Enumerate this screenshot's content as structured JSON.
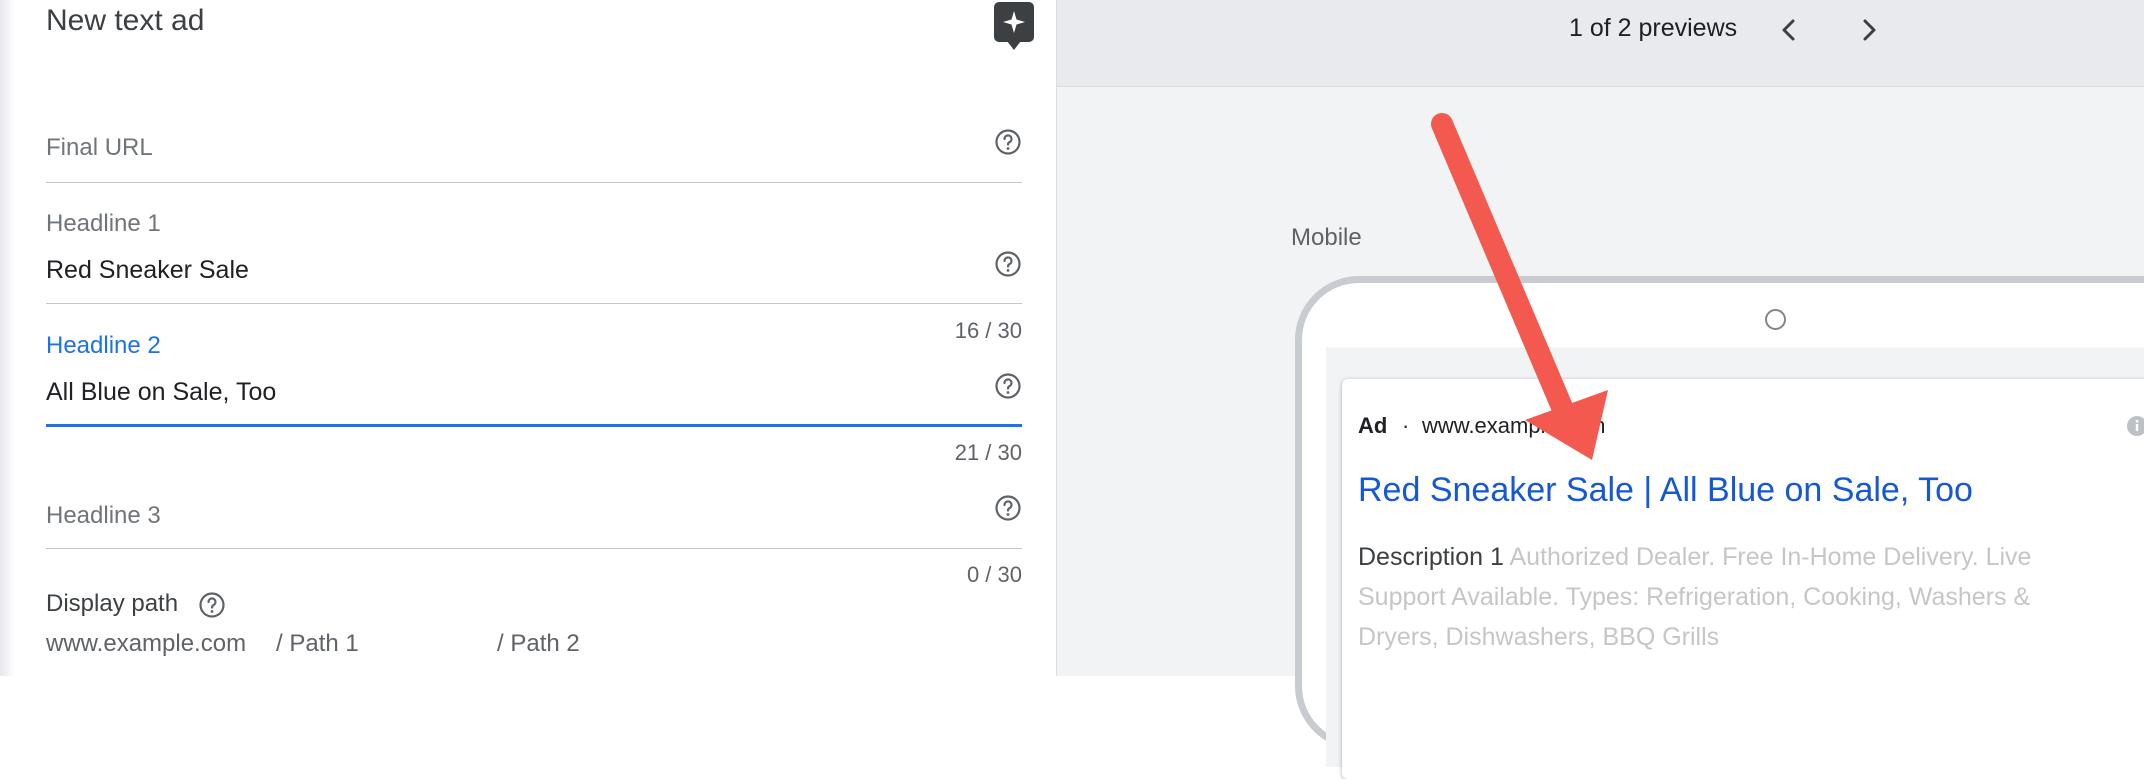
{
  "editor": {
    "title": "New text ad",
    "ai_icon": "sparkle-icon",
    "fields": [
      {
        "id": "final_url",
        "label": "Final URL",
        "value": "",
        "counter": ""
      },
      {
        "id": "headline_1",
        "label": "Headline 1",
        "value": "Red Sneaker Sale",
        "counter": "16 / 30"
      },
      {
        "id": "headline_2",
        "label": "Headline 2",
        "value": "All Blue on Sale, Too",
        "counter": "21 / 30"
      },
      {
        "id": "headline_3",
        "label": "Headline 3",
        "value": "",
        "counter": "0 / 30"
      }
    ],
    "display_path": {
      "label": "Display path",
      "domain": "www.example.com",
      "path1": "/ Path 1",
      "path2": "/ Path 2"
    }
  },
  "preview": {
    "count": "1 of 2 previews",
    "prev_icon": "chevron-left-icon",
    "next_icon": "chevron-right-icon",
    "device": "Mobile",
    "ad": {
      "badge": "Ad",
      "separator": "·",
      "url": "www.example.com",
      "headline": "Red Sneaker Sale | All Blue on Sale, Too",
      "description_label": "Description 1",
      "description_text": "Authorized Dealer. Free In-Home Delivery. Live Support Available. Types: Refrigeration, Cooking, Washers & Dryers, Dishwashers, BBQ Grills"
    }
  },
  "colors": {
    "accent": "#1a73e8",
    "ad_link": "#1558d6",
    "annotation_arrow": "#f4594f"
  }
}
